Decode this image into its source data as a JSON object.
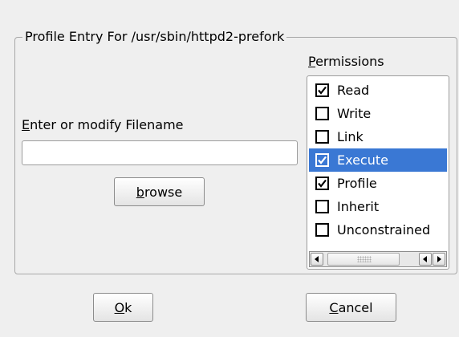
{
  "dialog": {
    "group_title": "Profile Entry For /usr/sbin/httpd2-prefork",
    "filename_label_mnemonic": "E",
    "filename_label_rest": "nter or modify Filename",
    "filename_value": "",
    "browse_mnemonic": "b",
    "browse_rest": "rowse",
    "ok_mnemonic": "O",
    "ok_rest": "k",
    "cancel_mnemonic": "C",
    "cancel_rest": "ancel"
  },
  "permissions": {
    "label_mnemonic": "P",
    "label_rest": "ermissions",
    "items": [
      {
        "label": "Read",
        "checked": true,
        "selected": false
      },
      {
        "label": "Write",
        "checked": false,
        "selected": false
      },
      {
        "label": "Link",
        "checked": false,
        "selected": false
      },
      {
        "label": "Execute",
        "checked": true,
        "selected": true
      },
      {
        "label": "Profile",
        "checked": true,
        "selected": false
      },
      {
        "label": "Inherit",
        "checked": false,
        "selected": false
      },
      {
        "label": "Unconstrained",
        "checked": false,
        "selected": false
      }
    ]
  },
  "colors": {
    "selection": "#3a78d4",
    "background": "#efefef"
  }
}
